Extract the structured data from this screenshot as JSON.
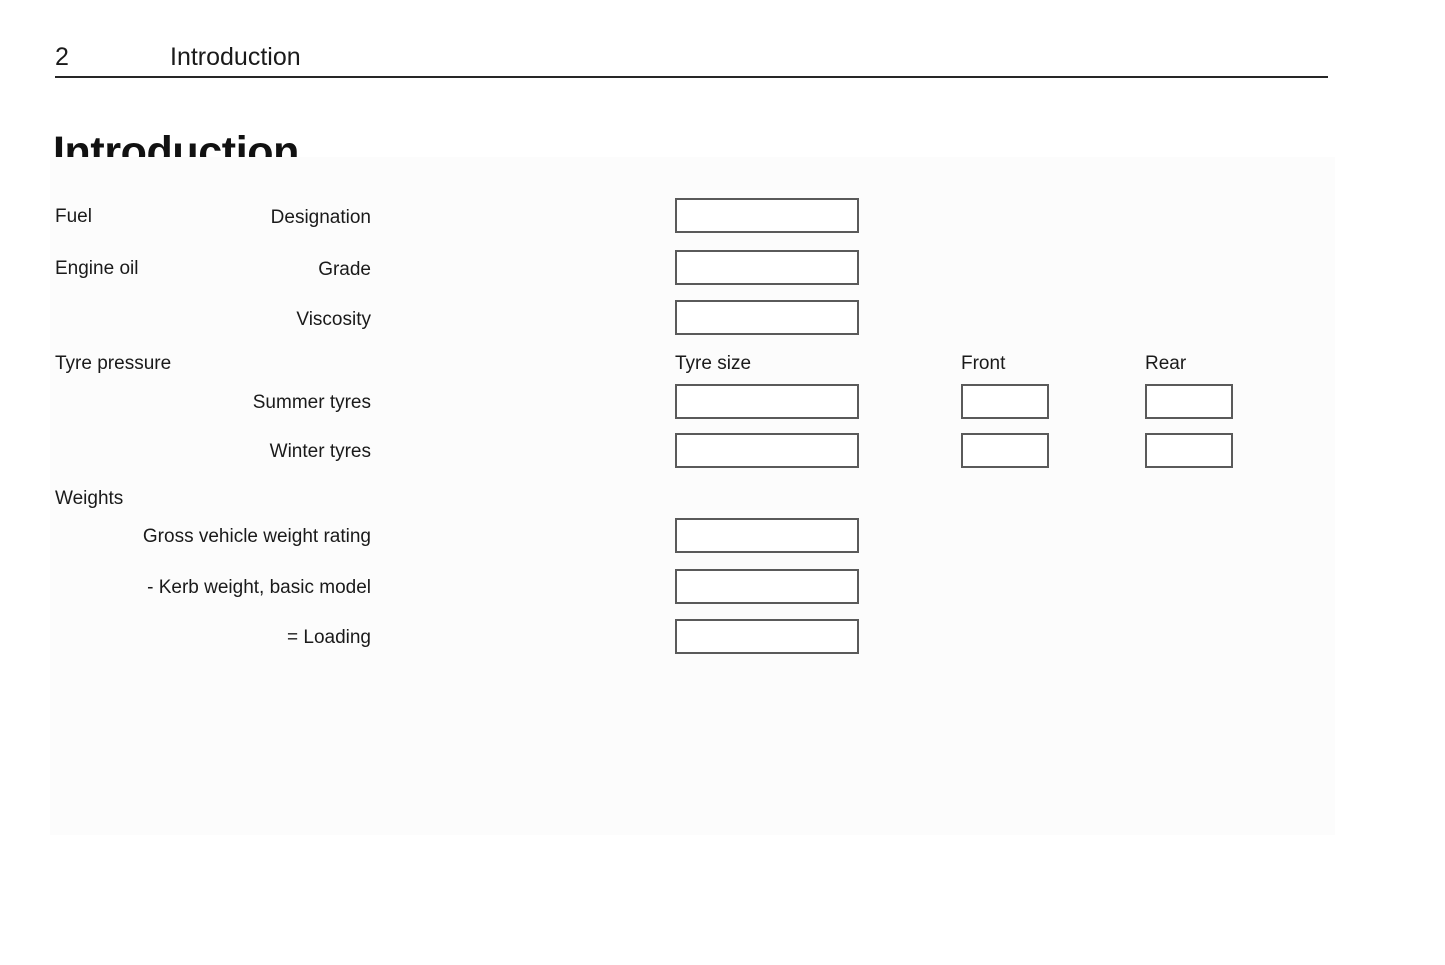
{
  "header": {
    "page_number": "2",
    "chapter": "Introduction"
  },
  "title": "Introduction",
  "columns": {
    "tyre_size": "Tyre size",
    "front": "Front",
    "rear": "Rear"
  },
  "sections": [
    {
      "label": "Fuel"
    },
    {
      "label": "Engine oil"
    },
    {
      "label": "Tyre pressure"
    },
    {
      "label": "Weights"
    }
  ],
  "rows": [
    {
      "label": "Designation",
      "value": ""
    },
    {
      "label": "Grade",
      "value": ""
    },
    {
      "label": "Viscosity",
      "value": ""
    },
    {
      "label": "Summer tyres",
      "value": "",
      "front": "",
      "rear": ""
    },
    {
      "label": "Winter tyres",
      "value": "",
      "front": "",
      "rear": ""
    },
    {
      "label": "Gross vehicle weight rating",
      "value": ""
    },
    {
      "label": "- Kerb weight, basic model",
      "value": ""
    },
    {
      "label": "= Loading",
      "value": ""
    }
  ]
}
